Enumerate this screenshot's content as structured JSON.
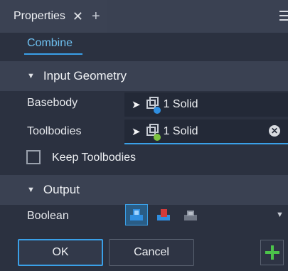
{
  "tab": {
    "title": "Properties",
    "close": "✕",
    "add": "+"
  },
  "subtab": {
    "label": "Combine"
  },
  "input_geometry": {
    "header": "Input Geometry",
    "basebody": {
      "label": "Basebody",
      "value": "1 Solid",
      "dot_color": "#2f8ee0"
    },
    "toolbodies": {
      "label": "Toolbodies",
      "value": "1 Solid",
      "dot_color": "#7dc23f",
      "clear": "✕"
    },
    "keep_toolbodies": {
      "label": "Keep Toolbodies",
      "checked": false
    }
  },
  "output": {
    "header": "Output",
    "boolean_label": "Boolean",
    "options": [
      "join-icon",
      "cut-icon",
      "intersect-icon"
    ],
    "selected": "join-icon"
  },
  "buttons": {
    "ok": "OK",
    "cancel": "Cancel",
    "add": "+"
  },
  "colors": {
    "accent": "#3aa0e8",
    "add_green": "#4cc44a"
  }
}
